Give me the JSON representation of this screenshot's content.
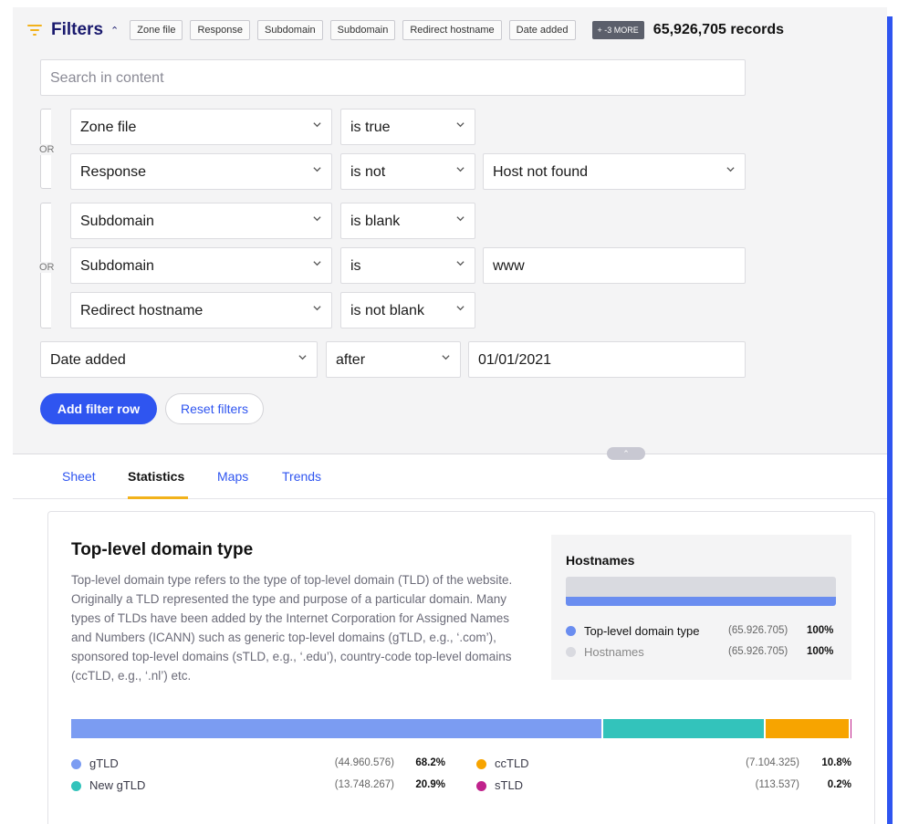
{
  "header": {
    "title": "Filters",
    "chips": [
      "Zone file",
      "Response",
      "Subdomain",
      "Subdomain",
      "Redirect hostname",
      "Date added"
    ],
    "more": "+ -3 MORE",
    "records": "65,926,705 records"
  },
  "search": {
    "placeholder": "Search in content"
  },
  "groups": {
    "or_label": "OR"
  },
  "rows": [
    {
      "field": "Zone file",
      "op": "is true",
      "value": ""
    },
    {
      "field": "Response",
      "op": "is not",
      "value": "Host not found"
    },
    {
      "field": "Subdomain",
      "op": "is blank",
      "value": ""
    },
    {
      "field": "Subdomain",
      "op": "is",
      "value": "www"
    },
    {
      "field": "Redirect hostname",
      "op": "is not blank",
      "value": ""
    },
    {
      "field": "Date added",
      "op": "after",
      "value": "01/01/2021"
    }
  ],
  "buttons": {
    "add": "Add filter row",
    "reset": "Reset filters"
  },
  "tabs": [
    "Sheet",
    "Statistics",
    "Maps",
    "Trends"
  ],
  "active_tab": "Statistics",
  "card": {
    "title": "Top-level domain type",
    "description": "Top-level domain type refers to the type of top-level domain (TLD) of the website. Originally a TLD represented the type and purpose of a particular domain. Many types of TLDs have been added by the Internet Corporation for Assigned Names and Numbers (ICANN) such as generic top-level domains (gTLD, e.g., ‘.com’), sponsored top-level domains (sTLD, e.g., ‘.edu’), country-code top-level domains (ccTLD, e.g., ‘.nl’) etc."
  },
  "hostnames": {
    "title": "Hostnames",
    "rows": [
      {
        "label": "Top-level domain type",
        "count": "(65.926.705)",
        "pct": "100%",
        "color": "#6a8df0"
      },
      {
        "label": "Hostnames",
        "count": "(65.926.705)",
        "pct": "100%",
        "color": "#d9dae0"
      }
    ]
  },
  "chart_data": {
    "type": "bar",
    "categories": [
      "gTLD",
      "New gTLD",
      "ccTLD",
      "sTLD"
    ],
    "values": [
      44960576,
      13748267,
      7104325,
      113537
    ],
    "percent": [
      68.2,
      20.9,
      10.8,
      0.2
    ],
    "colors": [
      "#7b9cf2",
      "#33c3bb",
      "#f7a400",
      "#c0228c"
    ]
  },
  "legend": [
    {
      "label": "gTLD",
      "count": "(44.960.576)",
      "pct": "68.2%"
    },
    {
      "label": "New gTLD",
      "count": "(13.748.267)",
      "pct": "20.9%"
    },
    {
      "label": "ccTLD",
      "count": "(7.104.325)",
      "pct": "10.8%"
    },
    {
      "label": "sTLD",
      "count": "(113.537)",
      "pct": "0.2%"
    }
  ]
}
